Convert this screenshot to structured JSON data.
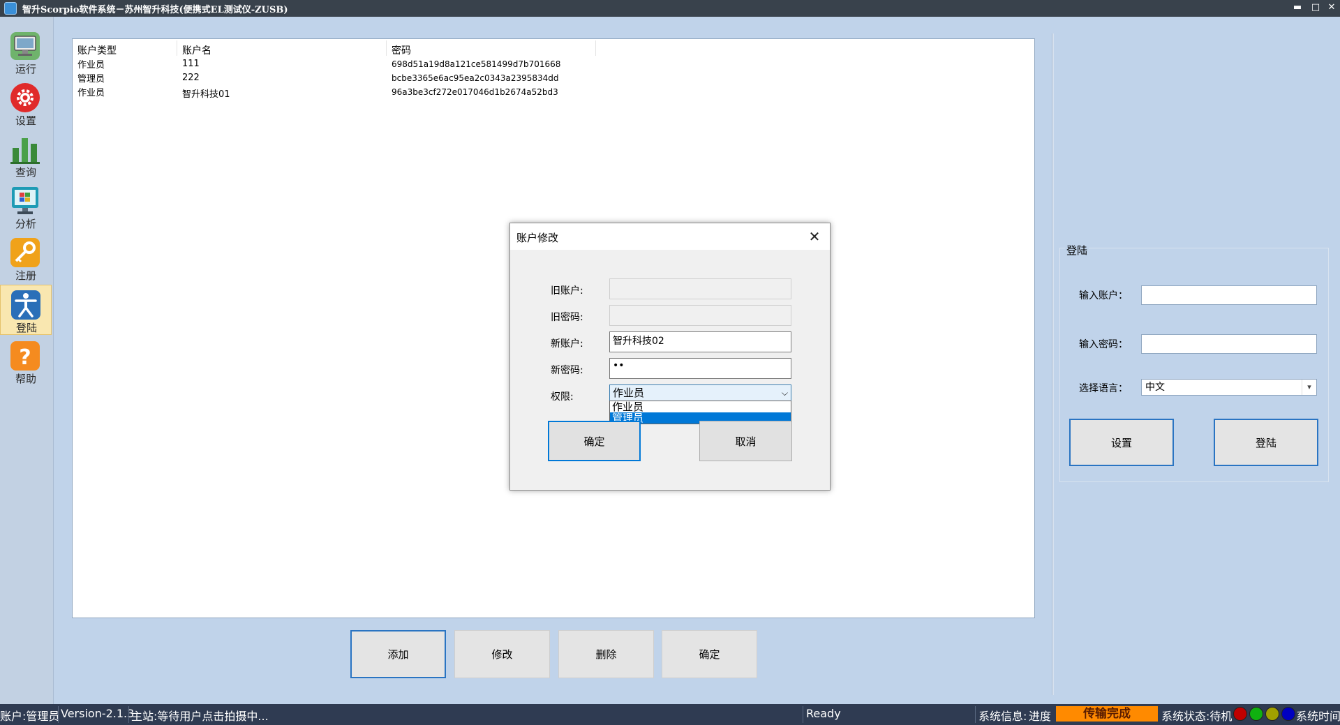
{
  "window": {
    "title": "智升Scorpio软件系统－苏州智升科技(便携式EL测试仪-ZUSB)",
    "controls": {
      "minimize": "▬",
      "maximize": "□",
      "close": "✕"
    }
  },
  "sidebar": {
    "items": [
      {
        "label": "运行",
        "icon": "monitor-icon"
      },
      {
        "label": "设置",
        "icon": "gear-icon"
      },
      {
        "label": "查询",
        "icon": "bar-chart-icon"
      },
      {
        "label": "分析",
        "icon": "windows-monitor-icon"
      },
      {
        "label": "注册",
        "icon": "key-icon"
      },
      {
        "label": "登陆",
        "icon": "accessibility-person-icon",
        "active": true
      },
      {
        "label": "帮助",
        "icon": "help-icon"
      }
    ]
  },
  "account_list": {
    "columns": [
      "账户类型",
      "账户名",
      "密码"
    ],
    "rows": [
      {
        "type": "作业员",
        "name": "111",
        "password": "698d51a19d8a121ce581499d7b701668"
      },
      {
        "type": "管理员",
        "name": "222",
        "password": "bcbe3365e6ac95ea2c0343a2395834dd"
      },
      {
        "type": "作业员",
        "name": "智升科技01",
        "password": "96a3be3cf272e017046d1b2674a52bd3"
      }
    ]
  },
  "bottom_buttons": {
    "add": "添加",
    "modify": "修改",
    "delete": "删除",
    "confirm": "确定"
  },
  "login_panel": {
    "title": "登陆",
    "account_label": "输入账户：",
    "account_value": "",
    "password_label": "输入密码：",
    "password_value": "",
    "language_label": "选择语言：",
    "language_value": "中文",
    "settings_button": "设置",
    "login_button": "登陆"
  },
  "dialog": {
    "title": "账户修改",
    "close": "✕",
    "old_account_label": "旧账户:",
    "old_account_value": "",
    "old_password_label": "旧密码:",
    "old_password_value": "",
    "new_account_label": "新账户:",
    "new_account_value": "智升科技02",
    "new_password_label": "新密码:",
    "new_password_value": "••",
    "permission_label": "权限:",
    "permission_value": "作业员",
    "permission_options": [
      "作业员",
      "管理员"
    ],
    "permission_highlighted": "管理员",
    "confirm_button": "确定",
    "cancel_button": "取消"
  },
  "status_bar": {
    "account": "账户:管理员",
    "version": "Version-2.1.3",
    "main_station": "主站:等待用户点击拍摄中...",
    "ready": "Ready",
    "system_info": "系统信息:",
    "progress_label": "进度",
    "progress_text": "传输完成",
    "system_state": "系统状态:待机",
    "system_time": "系统时间:",
    "indicator_colors": [
      "#c00000",
      "#10b010",
      "#a0a000",
      "#0000c0"
    ]
  },
  "colors": {
    "accent": "#0078d7",
    "title_bar": "#39424c",
    "status_bar": "#2f3b52",
    "progress": "#ff8a00",
    "background": "#c0d3ea"
  }
}
